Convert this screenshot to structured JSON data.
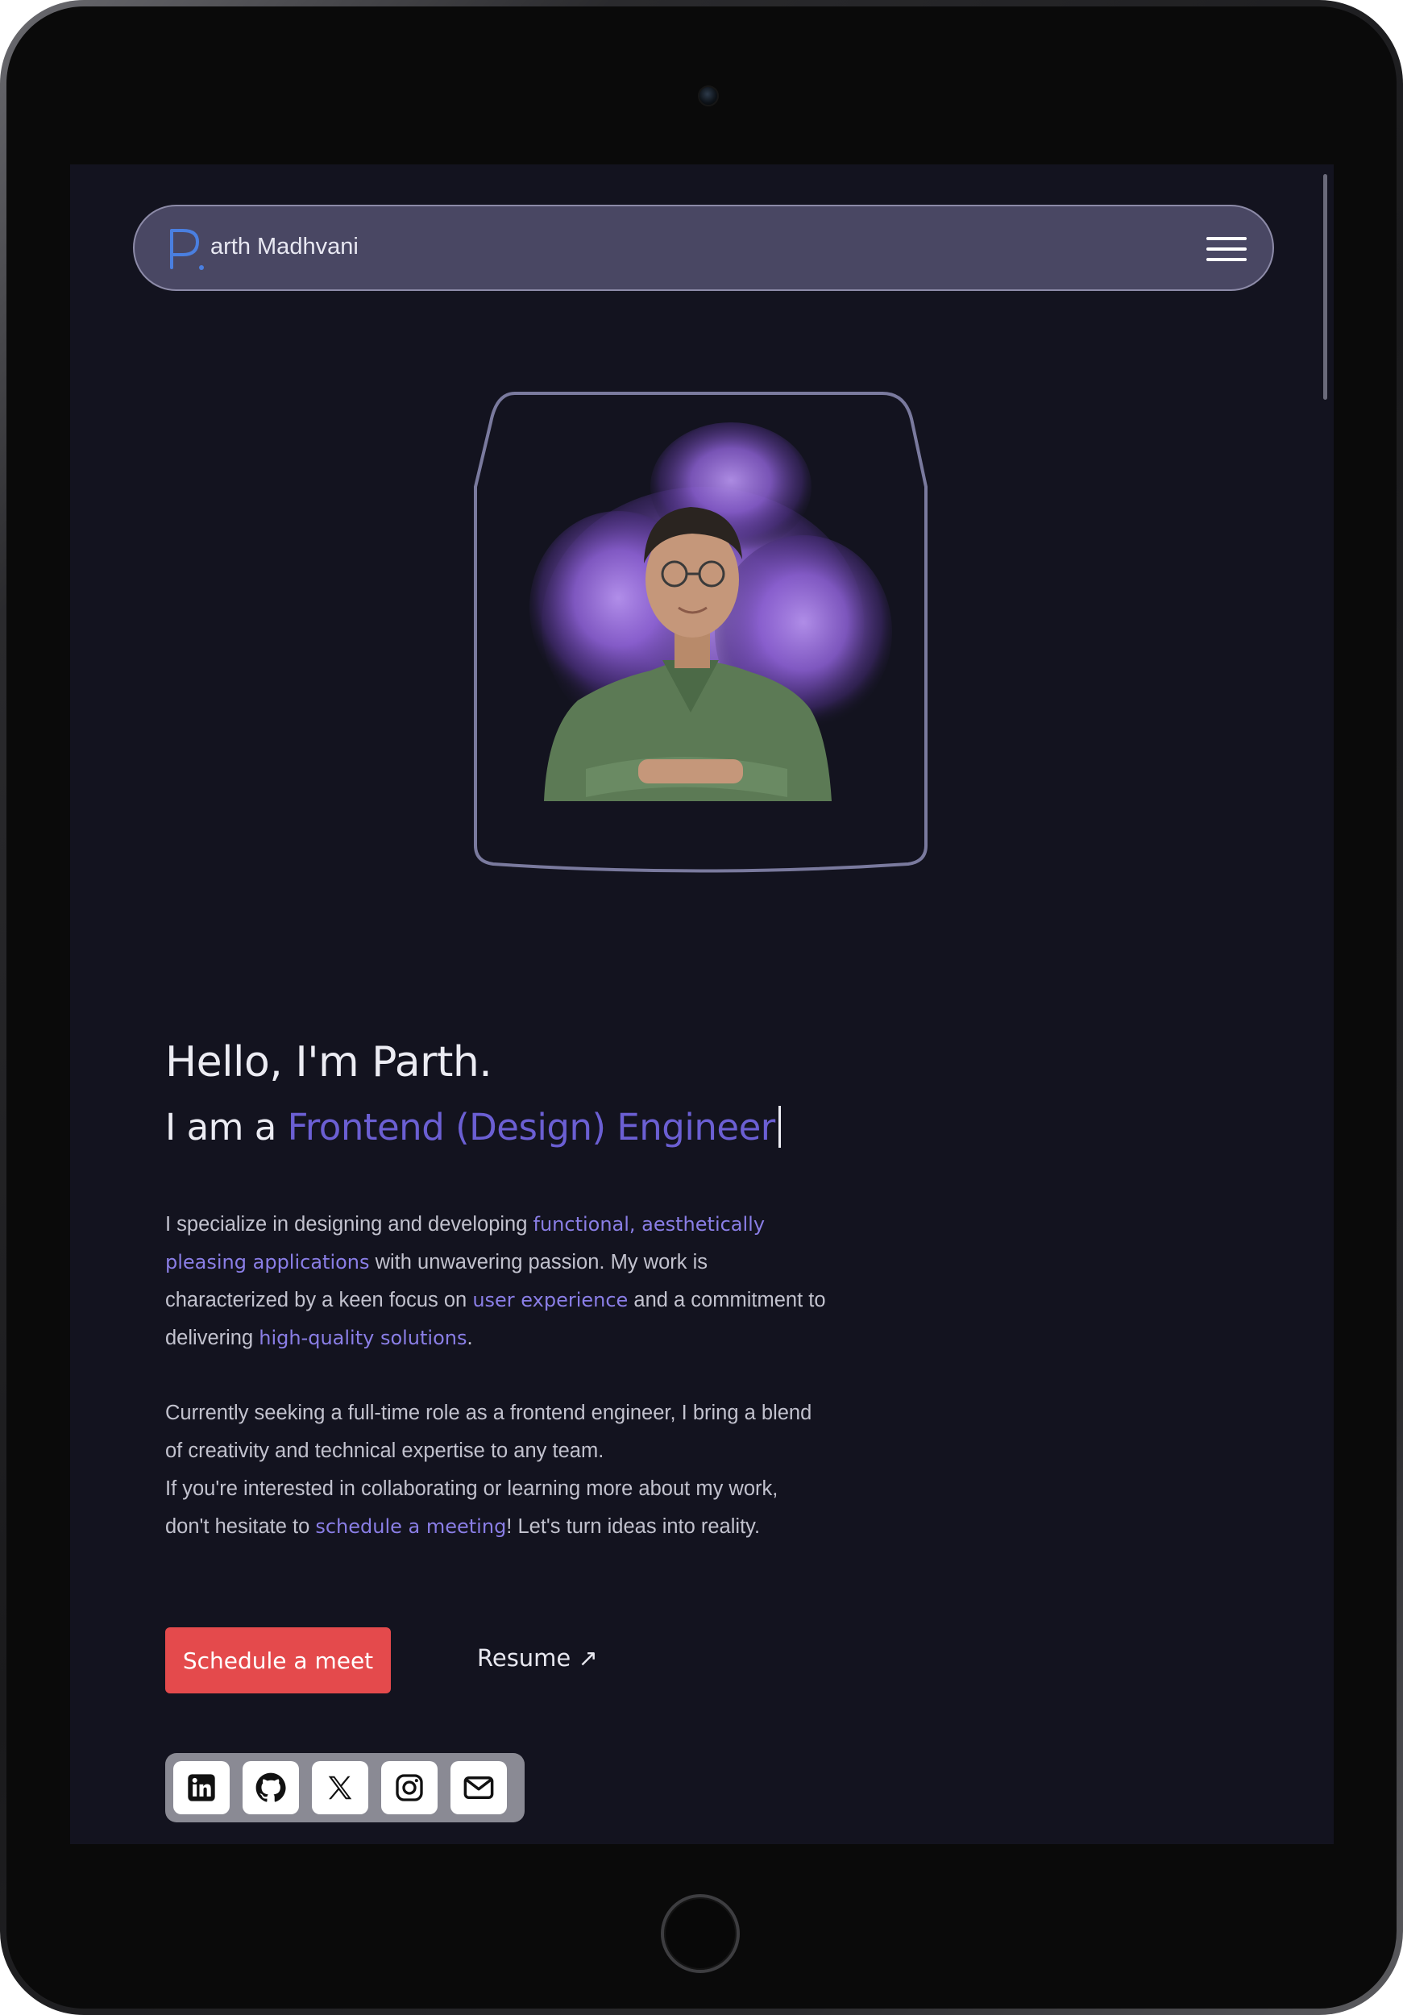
{
  "brand": {
    "name": "arth Madhvani"
  },
  "colors": {
    "background": "#13131f",
    "navbar": "#494763",
    "accent": "#6b5fd3",
    "highlight": "#8a7ee6",
    "cta": "#e44a4c"
  },
  "hero": {
    "greeting": "Hello, I'm Parth.",
    "role_prefix": "I am a ",
    "role": "Frontend (Design) Engineer",
    "p1": {
      "t1": "I specialize in designing and developing ",
      "h1": "functional, aesthetically pleasing applications",
      "t2": " with unwavering passion. My work is characterized by a keen focus on ",
      "h2": "user experience",
      "t3": " and a commitment to delivering ",
      "h3": "high-quality solutions",
      "t4": "."
    },
    "p2": "Currently seeking a full-time role as a frontend engineer, I bring a blend of creativity and technical expertise to any team.",
    "p3": {
      "t1": "If you're interested in collaborating or learning more about my work, don't hesitate to ",
      "h1": "schedule a meeting",
      "t2": "! Let's turn ideas into reality."
    }
  },
  "actions": {
    "schedule_label": "Schedule a meet",
    "resume_label": "Resume ↗"
  },
  "socials": [
    {
      "icon": "linkedin-icon"
    },
    {
      "icon": "github-icon"
    },
    {
      "icon": "x-icon"
    },
    {
      "icon": "instagram-icon"
    },
    {
      "icon": "mail-icon"
    }
  ]
}
